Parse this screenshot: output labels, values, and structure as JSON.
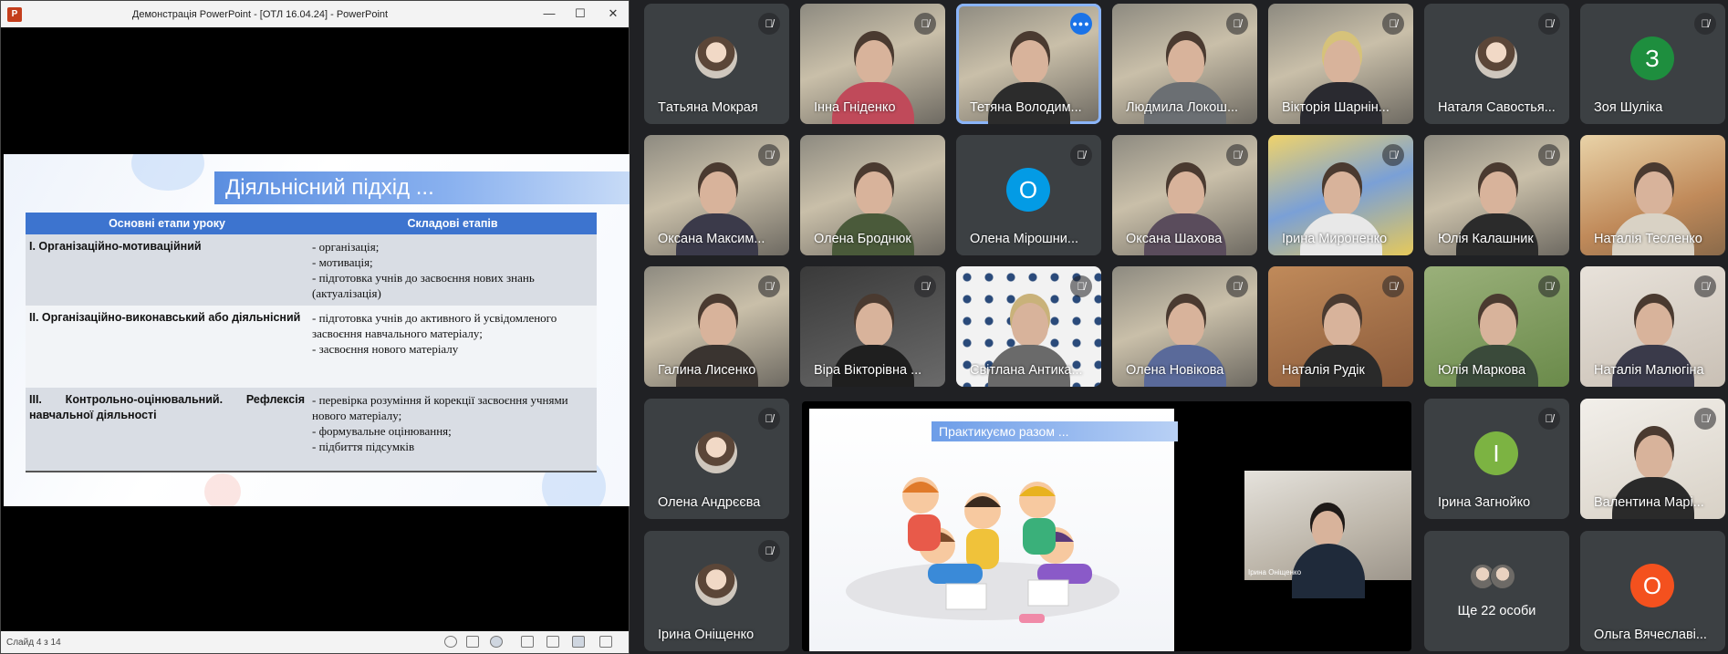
{
  "powerpoint": {
    "logo_letter": "P",
    "window_title": "Демонстрація PowerPoint - [ОТЛ 16.04.24] - PowerPoint",
    "controls": {
      "minimize": "—",
      "maximize": "☐",
      "close": "✕"
    },
    "slide": {
      "heading": "Діяльнісний підхід ...",
      "table_headers": [
        "Основні етапи уроку",
        "Складові етапів"
      ],
      "rows": [
        {
          "stage": "І. Організаційно-мотиваційний",
          "parts": [
            "- організація;",
            "- мотивація;",
            "- підготовка учнів до засвоєння нових знань (актуалізація)"
          ]
        },
        {
          "stage": "ІІ. Організаційно-виконавський або діяльнісний",
          "parts": [
            "-     підготовка учнів до активного й усвідомленого засвоєння навчального матеріалу;",
            "-     засвоєння нового матеріалу"
          ]
        },
        {
          "stage": "ІІІ.   Контрольно-оцінювальний.   Рефлексія навчальної діяльності",
          "parts": [
            "-     перевірка розуміння й корекції засвоєння учнями нового матеріалу;",
            "-     формувальне оцінювання;",
            "-     підбиття підсумків"
          ]
        }
      ]
    },
    "status_bar": {
      "slide_counter": "Слайд 4 з 14"
    }
  },
  "meeting": {
    "mic_muted_icon": "🎙̸",
    "participants": [
      {
        "name": "Тaтьяна Мокрая",
        "type": "photo-avatar"
      },
      {
        "name": "Інна Гніденко",
        "type": "video"
      },
      {
        "name": "Тетяна Володим...",
        "type": "video",
        "speaking": true
      },
      {
        "name": "Людмила Локош...",
        "type": "video"
      },
      {
        "name": "Вікторія Шарнін...",
        "type": "video"
      },
      {
        "name": "Наталя Савостья...",
        "type": "photo-avatar"
      },
      {
        "name": "Зоя Шуліка",
        "type": "letter",
        "letter": "З",
        "color": "#1e8e3e"
      },
      {
        "name": "Оксана Максим...",
        "type": "video"
      },
      {
        "name": "Олена Броднюк",
        "type": "video"
      },
      {
        "name": "Олена Мірошни...",
        "type": "letter",
        "letter": "О",
        "color": "#039be5"
      },
      {
        "name": "Оксана Шахова",
        "type": "video"
      },
      {
        "name": "Ірина Мироненко",
        "type": "video"
      },
      {
        "name": "Юлія Калашник",
        "type": "video"
      },
      {
        "name": "Наталія Тесленко",
        "type": "video"
      },
      {
        "name": "Галина Лисенко",
        "type": "video"
      },
      {
        "name": "Віра Вікторівна ...",
        "type": "video"
      },
      {
        "name": "Світлана Антика...",
        "type": "video"
      },
      {
        "name": "Олена Новікова",
        "type": "video"
      },
      {
        "name": "Наталія Рудік",
        "type": "video"
      },
      {
        "name": "Юлія Маркова",
        "type": "video"
      },
      {
        "name": "Наталія Малюгіна",
        "type": "video"
      },
      {
        "name": "Олена Андрєєва",
        "type": "photo-avatar"
      },
      {
        "name": "Ірина Загнойко",
        "type": "letter",
        "letter": "І",
        "color": "#7cb342"
      },
      {
        "name": "Валентина Марі...",
        "type": "video"
      },
      {
        "name": "Ірина Оніщенко",
        "type": "photo-avatar"
      },
      {
        "name": "Ольга Вячеславі...",
        "type": "letter",
        "letter": "О",
        "color": "#f4511e"
      }
    ],
    "more_people": "Ще 22 особи",
    "shared_screen": {
      "slide_heading": "Практикуємо разом ...",
      "presenter_caption": "Ірина Оніщенко"
    }
  }
}
